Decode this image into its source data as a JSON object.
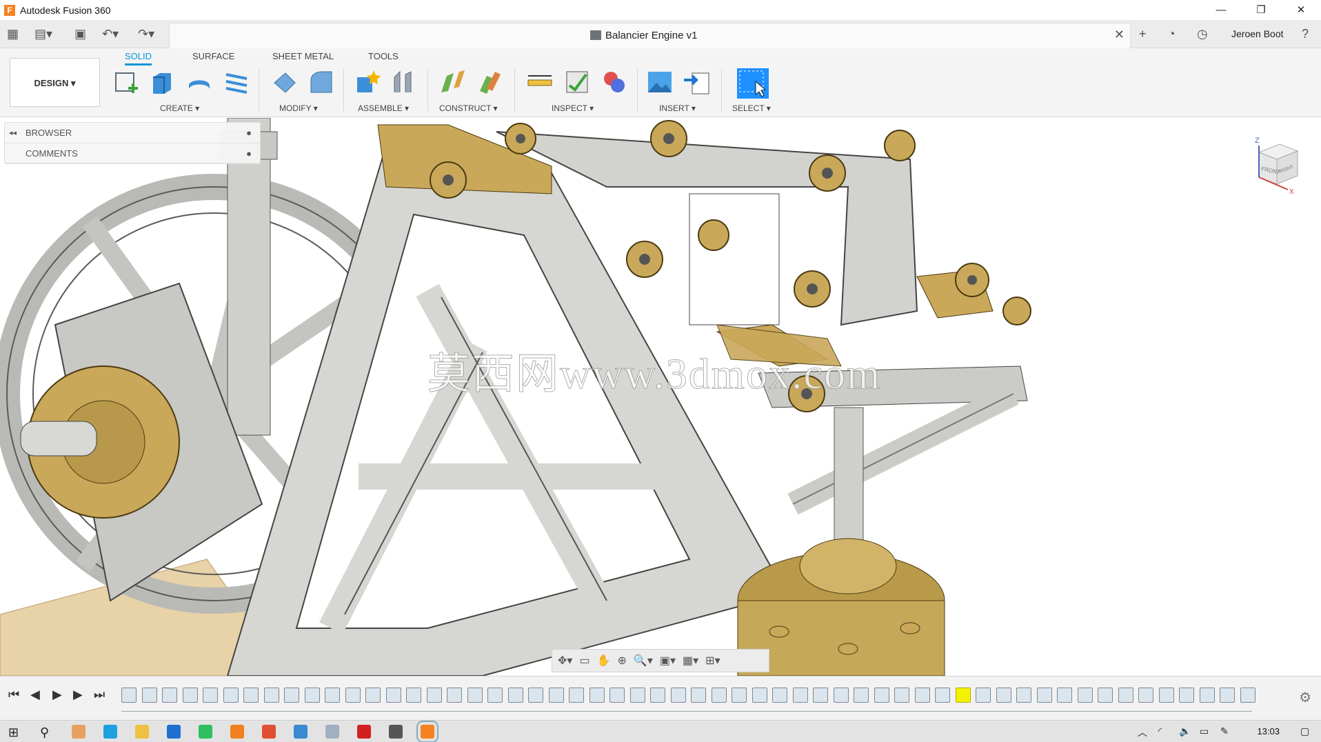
{
  "window": {
    "app_logo_letter": "F",
    "title": "Autodesk Fusion 360",
    "controls": [
      "—",
      "❐",
      "✕"
    ]
  },
  "docbar": {
    "document_title": "Balancier Engine v1",
    "close_symbol": "✕",
    "user_name": "Jeroen Boot"
  },
  "ribbon": {
    "workspace_button": "DESIGN ▾",
    "tabs": [
      {
        "label": "SOLID",
        "active": true
      },
      {
        "label": "SURFACE",
        "active": false
      },
      {
        "label": "SHEET METAL",
        "active": false
      },
      {
        "label": "TOOLS",
        "active": false
      }
    ],
    "groups": [
      {
        "label": "CREATE ▾"
      },
      {
        "label": "MODIFY ▾"
      },
      {
        "label": "ASSEMBLE ▾"
      },
      {
        "label": "CONSTRUCT ▾"
      },
      {
        "label": "INSPECT ▾"
      },
      {
        "label": "INSERT ▾"
      },
      {
        "label": "SELECT ▾"
      }
    ],
    "colors": {
      "accent": "#0696d7",
      "select_blue": "#1e90ff"
    }
  },
  "browser_panel": {
    "rows": [
      {
        "label": "BROWSER"
      },
      {
        "label": "COMMENTS"
      }
    ]
  },
  "viewcube": {
    "axis_z": "Z",
    "axis_x": "X",
    "face_front": "FRONT",
    "face_right": "RIGHT"
  },
  "watermark": "莫西网www.3dmox.com",
  "taskbar": {
    "clock": "13:03"
  }
}
